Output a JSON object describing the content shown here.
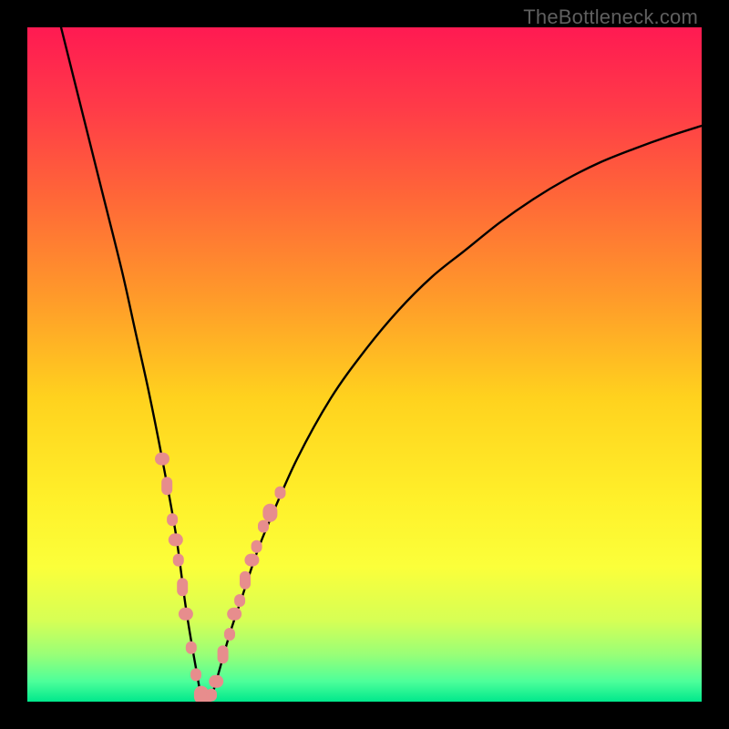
{
  "watermark": "TheBottleneck.com",
  "chart_data": {
    "type": "line",
    "title": "",
    "xlabel": "",
    "ylabel": "",
    "xlim": [
      0,
      100
    ],
    "ylim": [
      0,
      100
    ],
    "grid": false,
    "legend": null,
    "series": [
      {
        "name": "bottleneck-curve",
        "x": [
          5,
          8,
          11,
          14,
          16,
          18,
          20,
          22,
          23.5,
          25,
          26,
          27,
          28,
          30,
          32,
          34,
          36,
          40,
          45,
          50,
          55,
          60,
          65,
          70,
          75,
          80,
          85,
          90,
          95,
          100
        ],
        "y": [
          100,
          88,
          76,
          64,
          55,
          46,
          36,
          25,
          14,
          5,
          0,
          0,
          3,
          10,
          16,
          22,
          27,
          36,
          45,
          52,
          58,
          63,
          67,
          71,
          74.5,
          77.5,
          80,
          82,
          83.8,
          85.4
        ]
      }
    ],
    "markers": {
      "name": "highlight-dots",
      "color": "#e78d8d",
      "points": [
        {
          "x": 20.0,
          "y": 36
        },
        {
          "x": 20.7,
          "y": 32
        },
        {
          "x": 21.5,
          "y": 27
        },
        {
          "x": 22.0,
          "y": 24
        },
        {
          "x": 22.4,
          "y": 21
        },
        {
          "x": 23.0,
          "y": 17
        },
        {
          "x": 23.5,
          "y": 13
        },
        {
          "x": 24.3,
          "y": 8
        },
        {
          "x": 25.0,
          "y": 4
        },
        {
          "x": 25.8,
          "y": 1
        },
        {
          "x": 26.5,
          "y": 0
        },
        {
          "x": 27.3,
          "y": 1
        },
        {
          "x": 28.0,
          "y": 3
        },
        {
          "x": 29.0,
          "y": 7
        },
        {
          "x": 30.0,
          "y": 10
        },
        {
          "x": 30.7,
          "y": 13
        },
        {
          "x": 31.5,
          "y": 15
        },
        {
          "x": 32.3,
          "y": 18
        },
        {
          "x": 33.3,
          "y": 21
        },
        {
          "x": 34.0,
          "y": 23
        },
        {
          "x": 35.0,
          "y": 26
        },
        {
          "x": 36.0,
          "y": 28
        },
        {
          "x": 37.5,
          "y": 31
        }
      ]
    },
    "gradient_stops": [
      {
        "offset": 0.0,
        "color": "#ff1a52"
      },
      {
        "offset": 0.12,
        "color": "#ff3b48"
      },
      {
        "offset": 0.25,
        "color": "#ff6638"
      },
      {
        "offset": 0.4,
        "color": "#ff9a2a"
      },
      {
        "offset": 0.55,
        "color": "#ffd21e"
      },
      {
        "offset": 0.7,
        "color": "#fff02a"
      },
      {
        "offset": 0.8,
        "color": "#fbff3a"
      },
      {
        "offset": 0.88,
        "color": "#d6ff55"
      },
      {
        "offset": 0.93,
        "color": "#99ff77"
      },
      {
        "offset": 0.97,
        "color": "#4dff9a"
      },
      {
        "offset": 1.0,
        "color": "#00e88c"
      }
    ]
  }
}
